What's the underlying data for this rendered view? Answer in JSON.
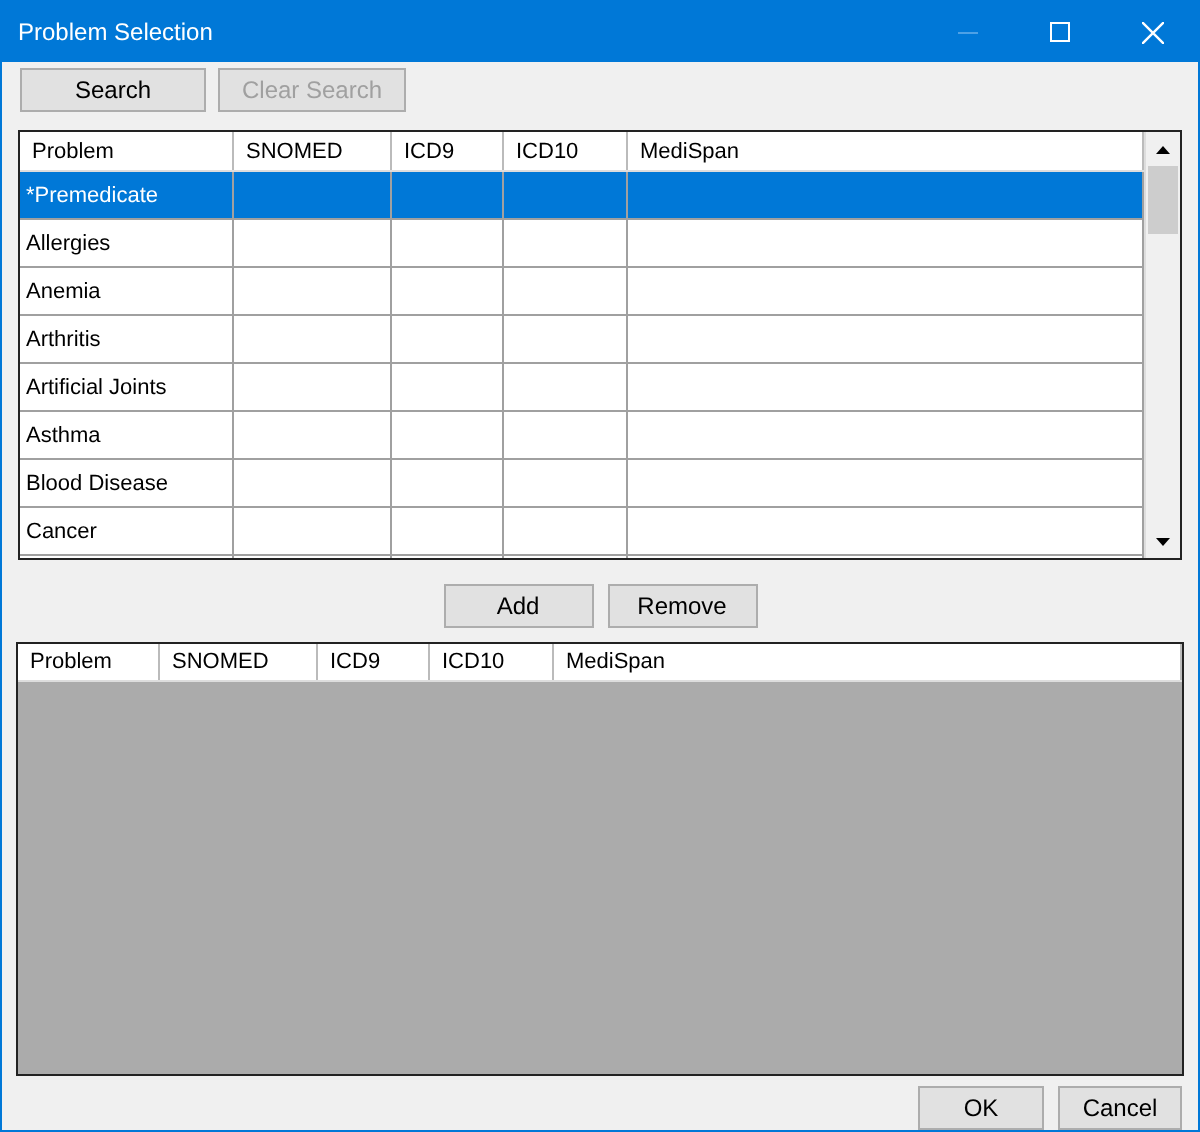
{
  "window": {
    "title": "Problem Selection",
    "minimize_disabled": true
  },
  "search_buttons": [
    {
      "label": "Search",
      "disabled": false
    },
    {
      "label": "Clear Search",
      "disabled": true
    }
  ],
  "problem_table": {
    "columns": [
      "Problem",
      "SNOMED",
      "ICD9",
      "ICD10",
      "MediSpan"
    ],
    "rows": [
      {
        "problem": "*Premedicate",
        "selected": true
      },
      {
        "problem": "Allergies",
        "selected": false
      },
      {
        "problem": "Anemia",
        "selected": false
      },
      {
        "problem": "Arthritis",
        "selected": false
      },
      {
        "problem": "Artificial Joints",
        "selected": false
      },
      {
        "problem": "Asthma",
        "selected": false
      },
      {
        "problem": "Blood Disease",
        "selected": false
      },
      {
        "problem": "Cancer",
        "selected": false
      }
    ]
  },
  "middle_buttons": [
    "Add",
    "Remove"
  ],
  "selected_table": {
    "columns": [
      "Problem",
      "SNOMED",
      "ICD9",
      "ICD10",
      "MediSpan"
    ]
  },
  "buttons": [
    "OK",
    "Cancel"
  ]
}
